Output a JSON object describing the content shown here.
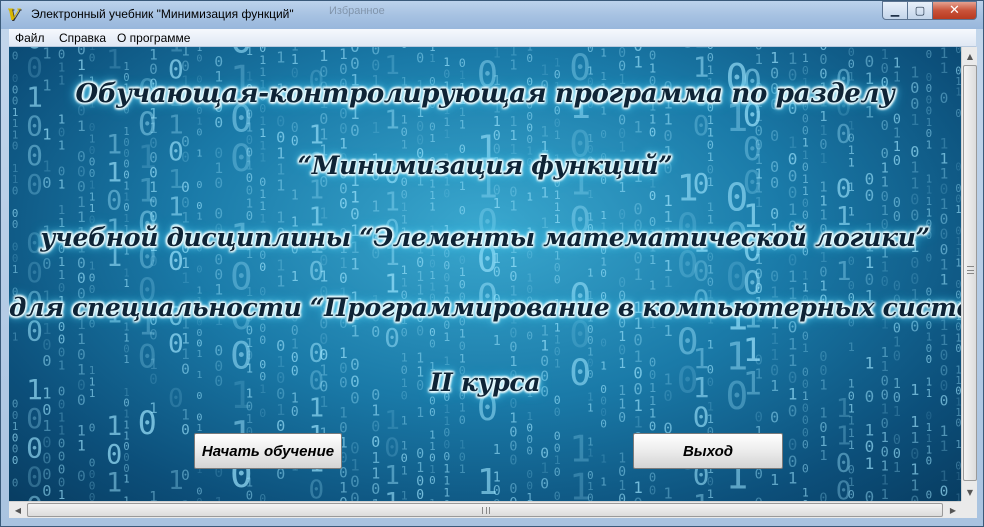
{
  "window": {
    "title": "Электронный учебник \"Минимизация функций\"",
    "background_tab": "Избранное"
  },
  "menu": {
    "items": [
      {
        "label": "Файл"
      },
      {
        "label": "Справка"
      },
      {
        "label": "О программе"
      }
    ]
  },
  "content": {
    "lines": [
      "Обучающая-контролирующая программа по разделу",
      "“Минимизация функций”",
      "учебной дисциплины “Элементы математической логики”",
      "для специальности “Программирование в компьютерных системах”",
      "II курса"
    ],
    "start_button": "Начать обучение",
    "exit_button": "Выход"
  },
  "colors": {
    "background_dark": "#083d62",
    "background_light": "#3aa8cf",
    "digit_color": "#9fe6ff",
    "heading_text": "#0f2436",
    "heading_glow": "#e8fbff"
  },
  "icons": {
    "app": "app-logo-icon",
    "minimize": "minimize-icon",
    "maximize": "maximize-icon",
    "close": "close-icon"
  }
}
